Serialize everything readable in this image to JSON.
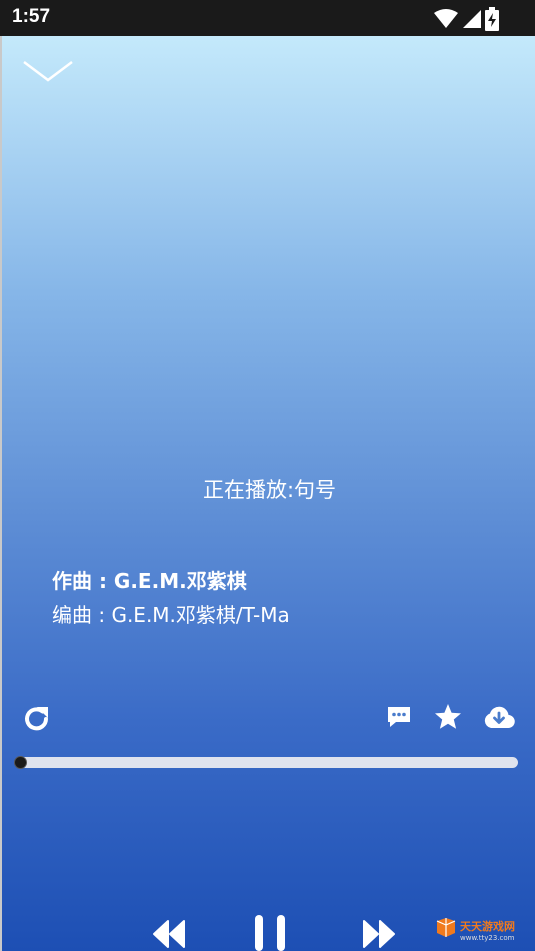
{
  "status_bar": {
    "time": "1:57",
    "icons": [
      "wifi-icon",
      "signal-icon",
      "battery-charging-icon"
    ]
  },
  "player": {
    "now_playing": "正在播放:句号",
    "composer": "作曲 : G.E.M.邓紫棋",
    "arranger": "编曲 : G.E.M.邓紫棋/T-Ma",
    "progress": 0.0,
    "actions": [
      "repeat-icon",
      "comment-icon",
      "favorite-star-icon",
      "download-cloud-icon"
    ],
    "transport": [
      "previous-icon",
      "pause-icon",
      "next-icon"
    ]
  },
  "watermark": {
    "title": "天天游戏网",
    "url": "www.tty23.com"
  },
  "colors": {
    "gradient_top": "#c4e9fb",
    "gradient_bottom": "#1d4fb4",
    "status_bar_bg": "#1a1a1a"
  }
}
